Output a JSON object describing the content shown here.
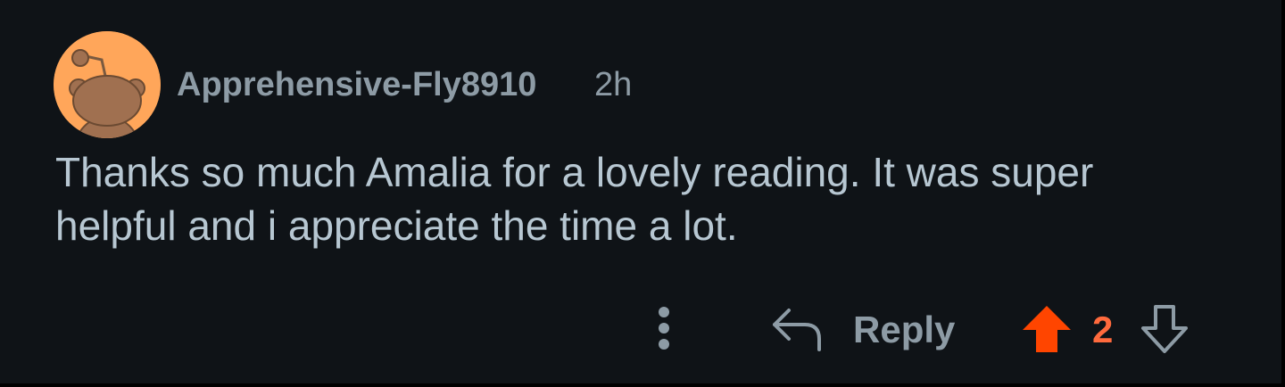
{
  "comment": {
    "author": "Apprehensive-Fly8910",
    "age": "2h",
    "body": "Thanks so much Amalia for a lovely reading. It was super helpful and i appreciate the time a lot.",
    "avatar_icon": "snoo-avatar-icon"
  },
  "actions": {
    "more_icon": "more-options-icon",
    "reply_icon": "reply-arrow-icon",
    "reply_label": "Reply",
    "upvote_icon": "upvote-arrow-icon",
    "vote_count": "2",
    "downvote_icon": "downvote-arrow-icon"
  },
  "colors": {
    "background": "#0f1317",
    "text_primary": "#b7c7d2",
    "text_secondary": "#8d9ba5",
    "upvote_active": "#ff4500",
    "vote_count": "#ff6a3d",
    "avatar_bg": "#ffa65a"
  }
}
